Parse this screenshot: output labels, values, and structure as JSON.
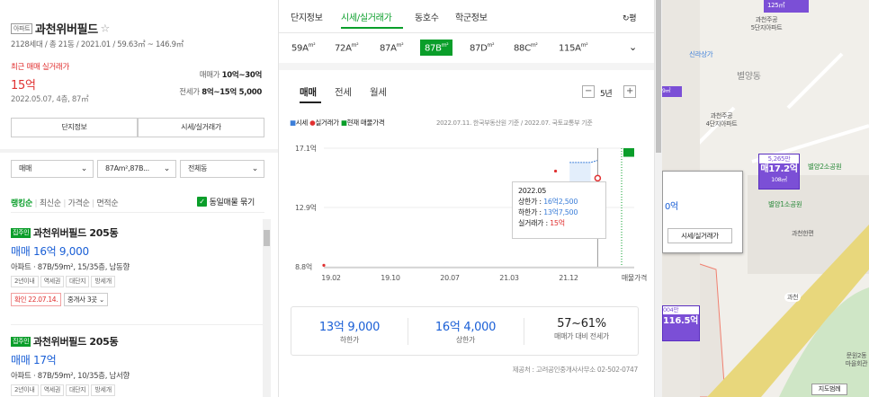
{
  "listing": {
    "badge": "아파트",
    "title": "과천위버필드",
    "star": "☆",
    "subtitle": "2128세대 / 총 21동 / 2021.01 / 59.63㎡ ~ 146.9㎡",
    "recent_label": "최근 매매 실거래가",
    "recent_price": "15억",
    "recent_date": "2022.05.07, 4층, 87㎡",
    "sale_label": "매매가",
    "sale_value": "10억~30억",
    "jeonse_label": "전세가",
    "jeonse_value": "8억~15억 5,000",
    "btn_info": "단지정보",
    "btn_price": "시세/실거래가"
  },
  "filters": {
    "type": "매매",
    "area": "87Am²,87B...",
    "dong": "전체동"
  },
  "sort": {
    "items": [
      "랭킹순",
      "최신순",
      "가격순",
      "면적순"
    ],
    "group": "동일매물 묶기"
  },
  "items": [
    {
      "badge": "집주인",
      "title": "과천위버필드 205동",
      "price": "매매 16억 9,000",
      "spec": "아파트 · 87B/59m², 15/35층, 남동향",
      "tags": [
        "2년이내",
        "역세권",
        "대단지",
        "방세개"
      ],
      "confirm": "확인 22.07.14.",
      "agents": "중개사 3곳"
    },
    {
      "badge": "집주인",
      "title": "과천위버필드 205동",
      "price": "매매 17억",
      "spec": "아파트 · 87B/59m², 10/35층, 남서향",
      "tags": [
        "2년이내",
        "역세권",
        "대단지",
        "방세개"
      ]
    }
  ],
  "tabs": {
    "items": [
      "단지정보",
      "시세/실거래가",
      "동호수",
      "학군정보"
    ],
    "refresh": "평"
  },
  "area_tabs": [
    {
      "n": "59A",
      "u": "m²"
    },
    {
      "n": "72A",
      "u": "m²"
    },
    {
      "n": "87A",
      "u": "m²"
    },
    {
      "n": "87B",
      "u": "m²"
    },
    {
      "n": "87D",
      "u": "m²"
    },
    {
      "n": "88C",
      "u": "m²"
    },
    {
      "n": "115A",
      "u": "m²"
    }
  ],
  "deal_tabs": [
    "매매",
    "전세",
    "월세"
  ],
  "period": {
    "minus": "−",
    "value": "5년",
    "plus": "+"
  },
  "legend": {
    "items": [
      "시세",
      "실거래가",
      "현재 매물가격"
    ],
    "source_note": "2022.07.11. 한국부동산원 기준 / 2022.07. 국토교통부 기준"
  },
  "colors": {
    "market": "#3d7fd9",
    "real": "#e03030",
    "current": "#0a9e2a",
    "selected_tab": "#0a9e2a"
  },
  "chart_data": {
    "type": "line",
    "y_ticks": [
      "17.1억",
      "12.9억",
      "8.8억"
    ],
    "x_ticks": [
      "19.02",
      "19.10",
      "20.07",
      "21.03",
      "21.12"
    ],
    "x_last": "매물가격",
    "ylim": [
      8.8,
      17.1
    ],
    "real_points": [
      {
        "x": "2019.02",
        "y": 8.9
      },
      {
        "x": "2021.11",
        "y": 15.5
      },
      {
        "x": "2022.05",
        "y": 15
      }
    ],
    "market_upper": [
      {
        "x": "2022.01",
        "y": 16.1
      },
      {
        "x": "2022.04",
        "y": 16.1
      },
      {
        "x": "2022.05",
        "y": 16.25
      }
    ],
    "market_lower": [
      {
        "x": "2022.01",
        "y": 13.75
      },
      {
        "x": "2022.05",
        "y": 13.75
      }
    ],
    "current_listing": [
      {
        "y": 16.5
      },
      {
        "y": 17.1
      }
    ],
    "tooltip": {
      "date": "2022.05",
      "upper_label": "상한가 : ",
      "upper": "16억2,500",
      "lower_label": "하한가 : ",
      "lower": "13억7,500",
      "real_label": "실거래가 : ",
      "real": "15억"
    }
  },
  "summary": {
    "low": "13억 9,000",
    "low_label": "하한가",
    "high": "16억 4,000",
    "high_label": "상한가",
    "ratio": "57~61%",
    "ratio_label": "매매가 대비 전세가"
  },
  "provider": "제공처 : 고려공인중개사사무소 02-502-0747",
  "map": {
    "l1": "125㎡",
    "l2": "과천주공",
    "l3": "5단지아파트",
    "l4": "신라상가",
    "l5": "별양동",
    "l6": "과천주공",
    "l7": "4단지아파트",
    "p1": "5,265만",
    "p2": "매17.2억",
    "p3": "108㎡",
    "l8": "별양2소공원",
    "l9": "별양1소공원",
    "l10": "과천한편",
    "pop_price": "0억",
    "pop_btn": "시세/실거래가",
    "p4": "004만",
    "p5": "116.5억",
    "l11": "과천",
    "l12": "문원2동",
    "l13": "마을회관",
    "btn_map": "지도범례",
    "l14": "9㎡"
  }
}
